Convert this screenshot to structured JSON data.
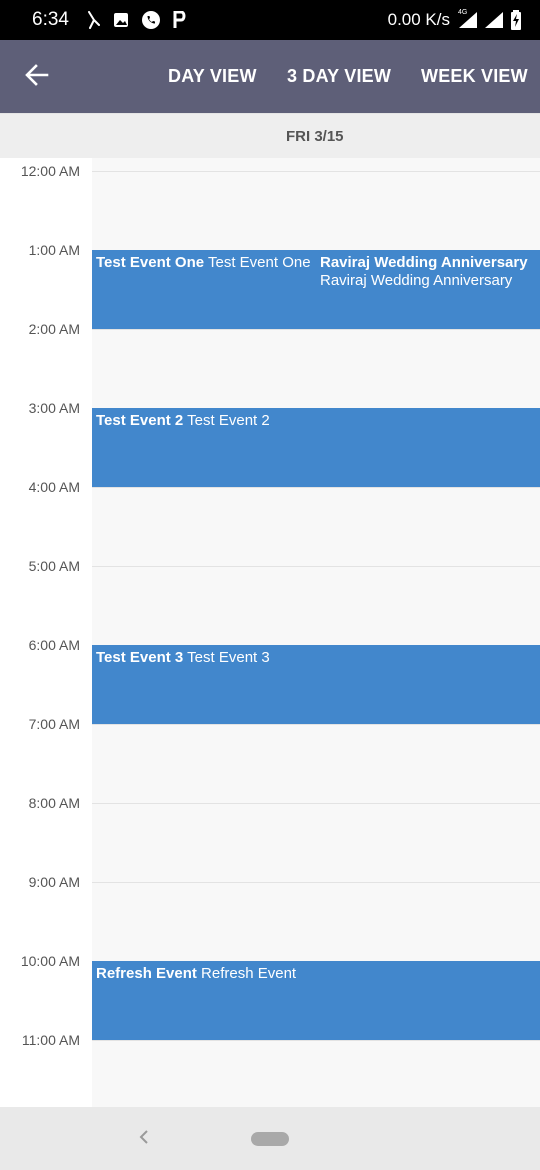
{
  "status_bar": {
    "time": "6:34",
    "net_speed": "0.00 K/s",
    "network_type": "4G",
    "icons_left": [
      "moon-icon",
      "image-icon",
      "whatsapp-icon",
      "p-app-icon"
    ],
    "icons_right": [
      "data-arrows-icon",
      "signal-icon",
      "signal-icon-2",
      "battery-charging-icon"
    ]
  },
  "app_bar": {
    "back_icon": "arrow-left-icon",
    "views": {
      "day": "DAY VIEW",
      "three_day": "3 DAY VIEW",
      "week": "WEEK VIEW"
    },
    "color": "#5e5f78"
  },
  "date_header": {
    "label": "FRI 3/15"
  },
  "calendar": {
    "hours": [
      "12:00 AM",
      "1:00 AM",
      "2:00 AM",
      "3:00 AM",
      "4:00 AM",
      "5:00 AM",
      "6:00 AM",
      "7:00 AM",
      "8:00 AM",
      "9:00 AM",
      "10:00 AM",
      "11:00 AM"
    ],
    "event_color": "#4287cc",
    "events": [
      {
        "title": "Test Event One",
        "subtitle": "Test Event One",
        "start": "1:00 AM",
        "end": "2:00 AM"
      },
      {
        "title": "Raviraj Wedding Anniversary",
        "subtitle": "Raviraj Wedding Anniversary",
        "start": "1:00 AM",
        "end": "2:00 AM"
      },
      {
        "title": "Test Event 2",
        "subtitle": "Test Event 2",
        "start": "3:00 AM",
        "end": "4:00 AM"
      },
      {
        "title": "Test Event 3",
        "subtitle": "Test Event 3",
        "start": "6:00 AM",
        "end": "7:00 AM"
      },
      {
        "title": "Refresh Event",
        "subtitle": "Refresh Event",
        "start": "10:00 AM",
        "end": "11:00 AM"
      }
    ]
  },
  "nav_bar": {
    "back_icon": "chevron-left-icon",
    "home_icon": "home-pill-icon"
  }
}
